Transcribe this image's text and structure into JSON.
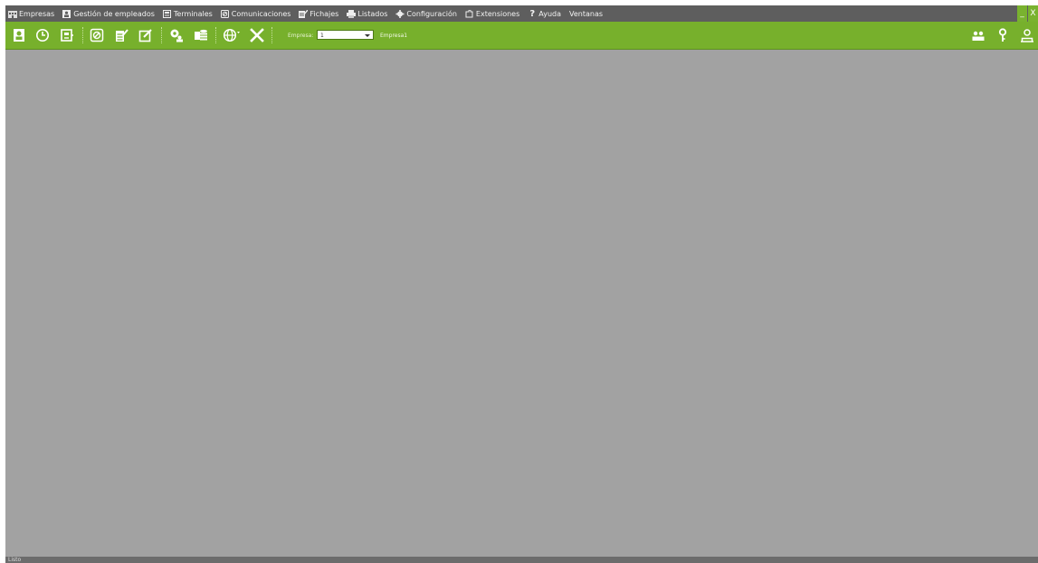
{
  "menu": {
    "items": [
      {
        "label": "Empresas",
        "icon": "building-icon"
      },
      {
        "label": "Gestión de empleados",
        "icon": "employee-card-icon"
      },
      {
        "label": "Terminales",
        "icon": "terminal-icon"
      },
      {
        "label": "Comunicaciones",
        "icon": "sync-icon"
      },
      {
        "label": "Fichajes",
        "icon": "clipboard-icon"
      },
      {
        "label": "Listados",
        "icon": "printer-icon"
      },
      {
        "label": "Configuración",
        "icon": "gear-icon"
      },
      {
        "label": "Extensiones",
        "icon": "extension-icon"
      },
      {
        "label": "Ayuda",
        "icon": "help-icon"
      },
      {
        "label": "Ventanas",
        "icon": ""
      }
    ]
  },
  "window": {
    "minimize": "_",
    "close": "X"
  },
  "toolbar": {
    "empresa_label": "Empresa:",
    "empresa_value": "1",
    "empresa_name": "Empresa1",
    "accent": "#77b02c"
  },
  "status": {
    "text": "Listo"
  }
}
